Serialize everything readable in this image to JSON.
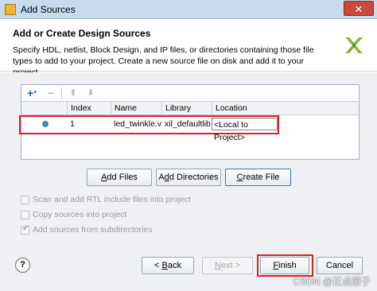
{
  "window": {
    "title": "Add Sources",
    "close_glyph": "✕"
  },
  "header": {
    "title": "Add or Create Design Sources",
    "description": "Specify HDL, netlist, Block Design, and IP files, or directories containing those file types to add to your project. Create a new source file on disk and add it to your project."
  },
  "toolbar": {
    "add_glyph": "+",
    "add_dropdown_glyph": "▾",
    "remove_glyph": "−",
    "up_glyph": "⬆",
    "down_glyph": "⬇"
  },
  "table": {
    "columns": [
      "",
      "Index",
      "Name",
      "Library",
      "Location"
    ],
    "rows": [
      {
        "status": "dot",
        "index": "1",
        "name": "led_twinkle.v",
        "library": "xil_defaultlib",
        "location": "<Local to Project>"
      }
    ]
  },
  "buttons": {
    "add_files": {
      "prefix": "",
      "underline": "A",
      "rest": "dd Files"
    },
    "add_directories": {
      "prefix": "A",
      "underline": "d",
      "rest": "d Directories"
    },
    "create_file": {
      "prefix": "",
      "underline": "C",
      "rest": "reate File"
    },
    "back": {
      "prefix": "< ",
      "underline": "B",
      "rest": "ack"
    },
    "next": {
      "prefix": "",
      "underline": "N",
      "rest": "ext >"
    },
    "finish": {
      "prefix": "",
      "underline": "F",
      "rest": "inish"
    },
    "cancel": {
      "label": "Cancel"
    },
    "help": {
      "label": "?"
    }
  },
  "options": [
    {
      "label": "Scan and add RTL include files into project",
      "checked": false,
      "enabled": false
    },
    {
      "label": "Copy sources into project",
      "checked": false,
      "enabled": false
    },
    {
      "label": "Add sources from subdirectories",
      "checked": true,
      "enabled": false
    }
  ],
  "watermark": "CSDN @正点原子",
  "colors": {
    "titlebar": "#c7daee",
    "highlight": "#e02020",
    "status_dot": "#3b8ab7",
    "create_file_border": "#3c72c2"
  }
}
